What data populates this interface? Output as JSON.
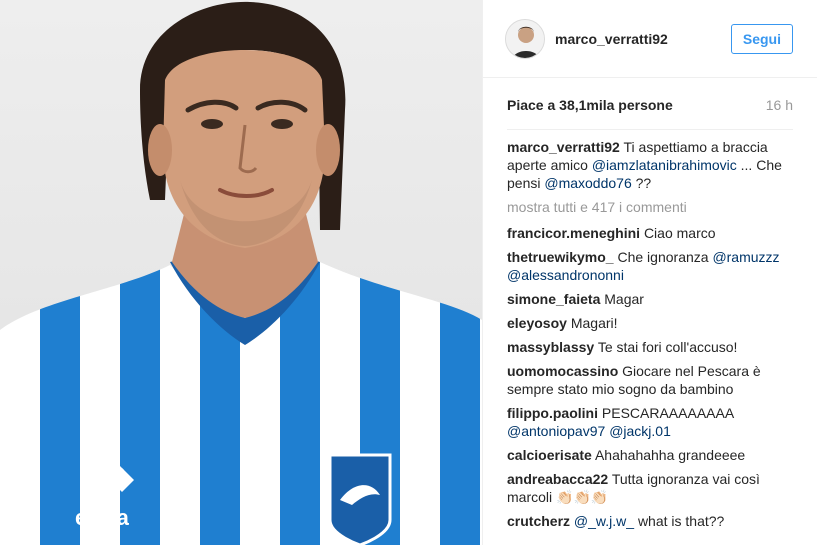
{
  "post": {
    "username": "marco_verratti92",
    "follow_label": "Segui",
    "likes": "Piace a 38,1mila persone",
    "time": "16 h",
    "caption": {
      "user": "marco_verratti92",
      "text1": "Ti aspettiamo a braccia aperte amico",
      "mention1": "@iamzlatanibrahimovic",
      "text2": "... Che pensi",
      "mention2": "@maxoddo76",
      "text3": "??"
    },
    "more_comments": "mostra tutti e 417 i commenti",
    "comments": [
      {
        "user": "francicor.meneghini",
        "text": "Ciao marco"
      },
      {
        "user": "thetruewikymo_",
        "text": "Che ignoranza",
        "mentions": [
          "@ramuzzz",
          "@alessandrononni"
        ]
      },
      {
        "user": "simone_faieta",
        "text": "Magar"
      },
      {
        "user": "eleyosoy",
        "text": "Magari!"
      },
      {
        "user": "massyblassy",
        "text": "Te stai fori coll'accuso!"
      },
      {
        "user": "uomomocassino",
        "text": "Giocare nel Pescara è sempre stato mio sogno da bambino"
      },
      {
        "user": "filippo.paolini",
        "text": "PESCARAAAAAAAA",
        "mentions": [
          "@antoniopav97",
          "@jackj.01"
        ]
      },
      {
        "user": "calcioerisate",
        "text": "Ahahahahha grandeeee"
      },
      {
        "user": "andreabacca22",
        "text": "Tutta ignoranza vai così marcoli",
        "emoji": "👏🏻👏🏻👏🏻"
      },
      {
        "user": "crutcherz",
        "text": "what is that??",
        "mentions": [
          "@_w.j.w_"
        ]
      }
    ]
  },
  "photo": {
    "jersey_brand": "errea",
    "jersey_colors": [
      "#1f7fd0",
      "#ffffff"
    ],
    "background_color": "#e8e8e8"
  }
}
